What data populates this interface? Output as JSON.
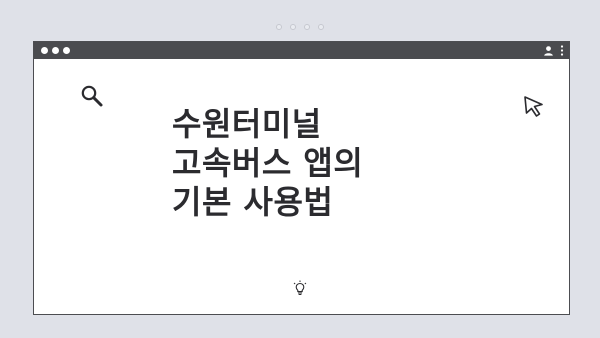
{
  "headline": {
    "line1": "수원터미널",
    "line2": "고속버스 앱의",
    "line3": "기본 사용법"
  },
  "icons": {
    "search": "search-icon",
    "cursor": "cursor-arrow-icon",
    "lightbulb": "lightbulb-icon",
    "profile": "profile-icon",
    "menu": "kebab-menu-icon"
  },
  "colors": {
    "background": "#dfe1e8",
    "titlebar": "#4a4b4f",
    "window": "#ffffff",
    "text": "#2b2b2f"
  }
}
